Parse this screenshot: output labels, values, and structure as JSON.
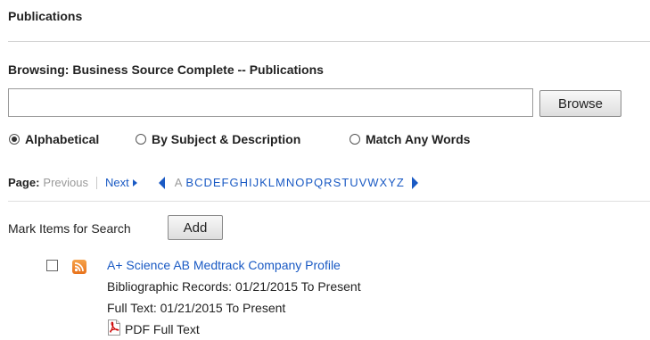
{
  "header": {
    "title": "Publications"
  },
  "browsing": {
    "text": "Browsing:  Business Source Complete -- Publications"
  },
  "search": {
    "value": "",
    "placeholder": "",
    "button_label": "Browse"
  },
  "radios": [
    {
      "label": "Alphabetical",
      "selected": true
    },
    {
      "label": "By Subject & Description",
      "selected": false
    },
    {
      "label": "Match Any Words",
      "selected": false
    }
  ],
  "pager": {
    "label": "Page:",
    "previous": "Previous",
    "next": "Next",
    "current_letter": "A",
    "letters": [
      "B",
      "C",
      "D",
      "E",
      "F",
      "G",
      "H",
      "I",
      "J",
      "K",
      "L",
      "M",
      "N",
      "O",
      "P",
      "Q",
      "R",
      "S",
      "T",
      "U",
      "V",
      "W",
      "X",
      "Y",
      "Z"
    ]
  },
  "mark": {
    "label": "Mark Items for Search",
    "add_label": "Add"
  },
  "results": [
    {
      "title": "A+ Science AB Medtrack Company Profile",
      "biblio": "Bibliographic Records: 01/21/2015 To Present",
      "fulltext": "Full Text: 01/21/2015 To Present",
      "pdf_label": "PDF Full Text",
      "icons": [
        "rss-icon",
        "pdf-icon"
      ]
    }
  ],
  "colors": {
    "link": "#1a5ac4",
    "muted": "#9a9a9a",
    "rss": "#e8721c",
    "pdf": "#cc0000"
  }
}
